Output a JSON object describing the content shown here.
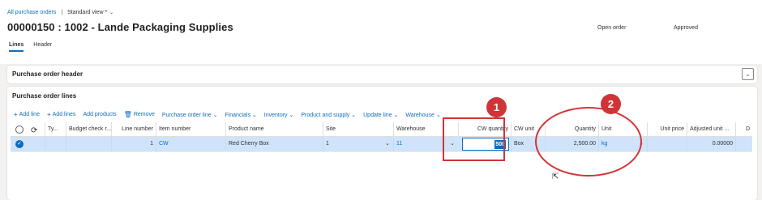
{
  "breadcrumb": {
    "link": "All purchase orders",
    "separator": "|",
    "view": "Standard view *",
    "chevron": "⌄"
  },
  "title": "00000150 : 1002 - Lande Packaging Supplies",
  "status": {
    "state": "Open order",
    "approval": "Approved"
  },
  "tabs": [
    {
      "label": "Lines"
    },
    {
      "label": "Header"
    }
  ],
  "header_panel": {
    "label": "Purchase order header",
    "expander": "⌄"
  },
  "lines_panel": {
    "label": "Purchase order lines",
    "toolbar": [
      {
        "icon": "+",
        "label": "Add line"
      },
      {
        "icon": "+",
        "label": "Add lines"
      },
      {
        "icon": "",
        "label": "Add products"
      },
      {
        "icon": "🗑",
        "label": "Remove"
      },
      {
        "icon": "",
        "label": "Purchase order line ⌄"
      },
      {
        "icon": "",
        "label": "Financials ⌄"
      },
      {
        "icon": "",
        "label": "Inventory ⌄"
      },
      {
        "icon": "",
        "label": "Product and supply ⌄"
      },
      {
        "icon": "",
        "label": "Update line ⌄"
      },
      {
        "icon": "",
        "label": "Warehouse ⌄"
      }
    ],
    "columns": {
      "type": "Ty...",
      "budget": "Budget check r...",
      "line_number": "Line number",
      "item_number": "Item number",
      "product_name": "Product name",
      "site": "Site",
      "warehouse": "Warehouse",
      "cw_quantity": "CW quantity",
      "cw_unit": "CW unit",
      "quantity": "Quantity",
      "unit": "Unit",
      "unit_price": "Unit price",
      "adjusted_unit": "Adjusted unit ...",
      "d": "D"
    },
    "row": {
      "line_number": "1",
      "item_number": "CW",
      "product_name": "Red Cherry Box",
      "site": "1",
      "warehouse": "11",
      "cw_quantity": "500",
      "cw_unit": "Box",
      "quantity": "2,500.00",
      "unit": "kg",
      "adjusted_unit": "0.00000"
    }
  },
  "annotations": {
    "badge1": "1",
    "badge2": "2"
  },
  "colors": {
    "accent": "#0f6cbd",
    "annotation": "#d13438",
    "selected_row": "#cfe4fa"
  }
}
